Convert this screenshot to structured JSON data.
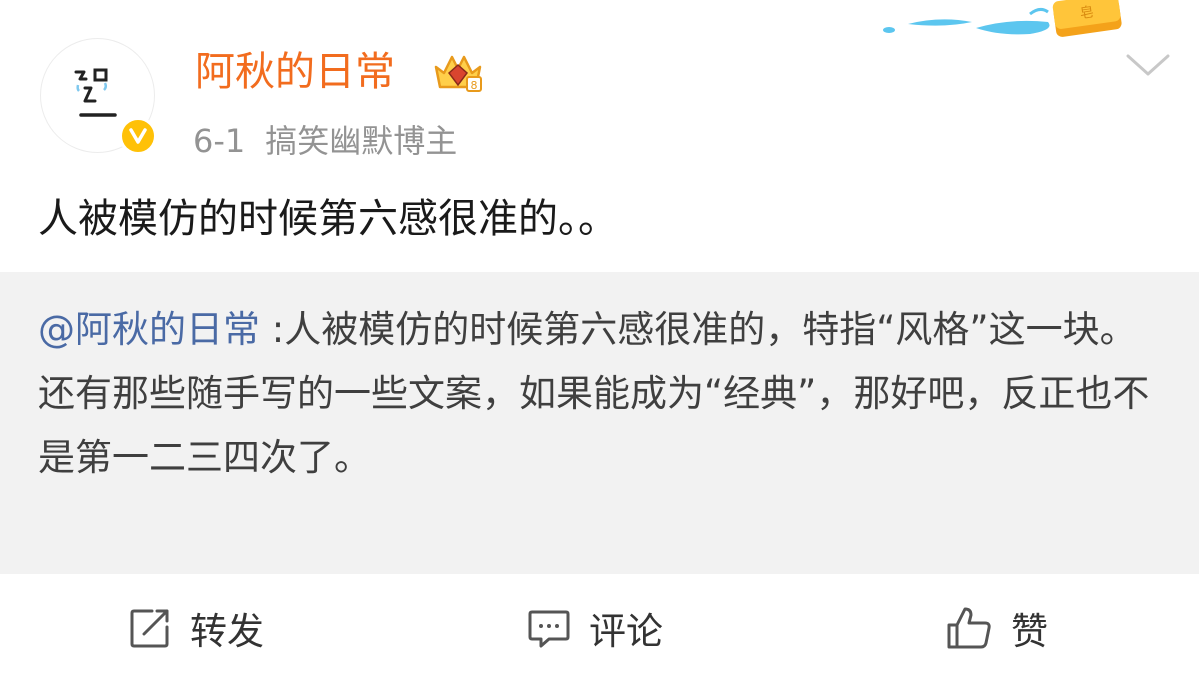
{
  "post": {
    "author": "阿秋的日常",
    "date": "6-1",
    "author_tag": "搞笑幽默博主",
    "text": "人被模仿的时候第六感很准的。。"
  },
  "quote": {
    "mention": "@阿秋的日常",
    "line1": " :人被模仿的时候第六感很准的，特指“风格”这一块。",
    "line2": "还有那些随手写的一些文案，如果能成为“经典”，那好吧，反正也不是第一二三四次了。"
  },
  "actions": {
    "repost": "转发",
    "comment": "评论",
    "like": "赞"
  },
  "icons": {
    "verified": "verified-v-icon",
    "crown": "crown-badge-icon",
    "more": "chevron-down-icon",
    "repost": "share-icon",
    "comment": "comment-icon",
    "like": "thumbs-up-icon"
  },
  "colors": {
    "username": "#f26c1e",
    "mention": "#4a6aa5",
    "verified": "#ffc107",
    "quote_bg": "#f2f2f2"
  }
}
